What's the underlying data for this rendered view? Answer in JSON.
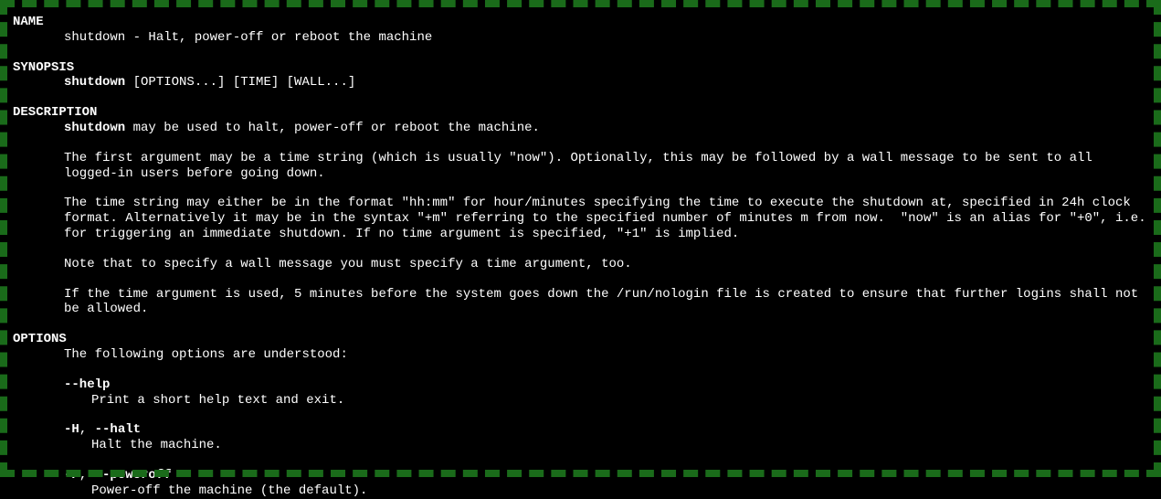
{
  "sections": {
    "name": {
      "header": "NAME",
      "line": "shutdown - Halt, power-off or reboot the machine"
    },
    "synopsis": {
      "header": "SYNOPSIS",
      "cmd": "shutdown",
      "args": " [OPTIONS...] [TIME] [WALL...]"
    },
    "description": {
      "header": "DESCRIPTION",
      "cmd": "shutdown",
      "intro": " may be used to halt, power-off or reboot the machine.",
      "para1": "The first argument may be a time string (which is usually \"now\"). Optionally, this may be followed by a wall message to be sent to all logged-in users before going down.",
      "para2": "The time string may either be in the format \"hh:mm\" for hour/minutes specifying the time to execute the shutdown at, specified in 24h clock format. Alternatively it may be in the syntax \"+m\" referring to the specified number of minutes m from now.  \"now\" is an alias for \"+0\", i.e. for triggering an immediate shutdown. If no time argument is specified, \"+1\" is implied.",
      "para3": "Note that to specify a wall message you must specify a time argument, too.",
      "para4": "If the time argument is used, 5 minutes before the system goes down the /run/nologin file is created to ensure that further logins shall not be allowed."
    },
    "options": {
      "header": "OPTIONS",
      "intro": "The following options are understood:",
      "opt1": {
        "flag": "--help",
        "desc": "Print a short help text and exit."
      },
      "opt2": {
        "flag1": "-H",
        "sep": ", ",
        "flag2": "--halt",
        "desc": "Halt the machine."
      },
      "opt3": {
        "flag1": "-P",
        "sep": ", ",
        "flag2": "--poweroff",
        "desc": "Power-off the machine (the default)."
      }
    }
  }
}
